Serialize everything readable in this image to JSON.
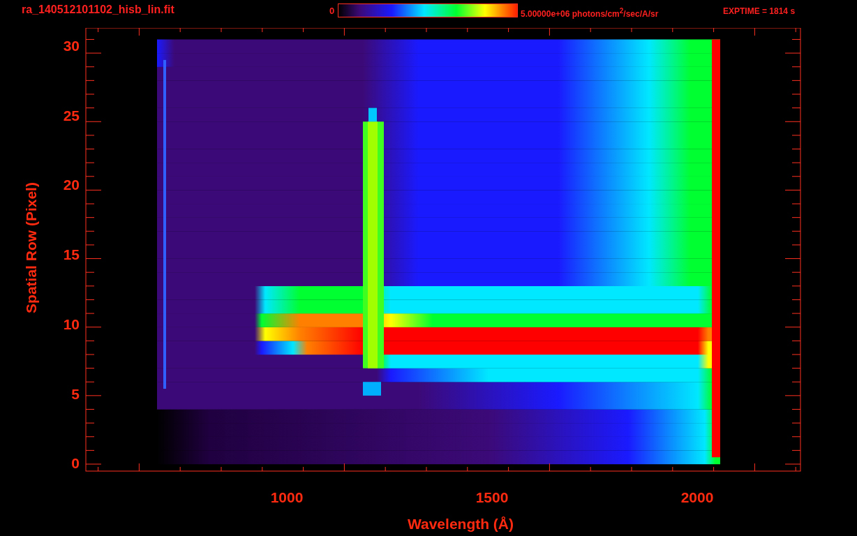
{
  "header": {
    "file_name": "ra_140512101102_hisb_lin.fit",
    "colorbar": {
      "min_label": "0",
      "max_label": "5.00000e+06 photons/cm$^{2}$/sec/A/sr"
    },
    "exposure": "EXPTIME = 1814 s"
  },
  "plot": {
    "xlabel": "Wavelength (Å)",
    "ylabel": "Spatial Row (Pixel)",
    "xtick_labels": [
      "1000",
      "1500",
      "2000"
    ],
    "ytick_labels": [
      "30",
      "25",
      "20",
      "15",
      "10",
      "5",
      "0"
    ]
  }
}
